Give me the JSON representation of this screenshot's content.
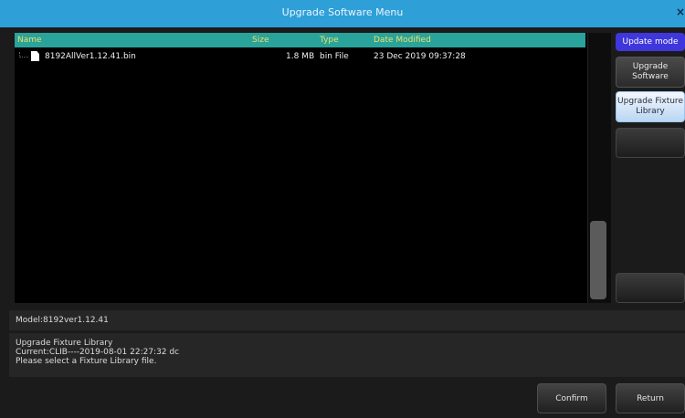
{
  "window": {
    "title": "Upgrade Software Menu",
    "close_glyph": "×"
  },
  "file_table": {
    "columns": {
      "name": "Name",
      "size": "Size",
      "type": "Type",
      "date": "Date Modified"
    },
    "rows": [
      {
        "name": "8192AllVer1.12.41.bin",
        "size": "1.8 MB",
        "type": "bin File",
        "date": "23 Dec 2019 09:37:28"
      }
    ],
    "scroll_position": 0.7
  },
  "side_menu": {
    "update_mode": "Update mode",
    "upgrade_software": "Upgrade Software",
    "upgrade_fixture_library": "Upgrade Fixture Library"
  },
  "status": {
    "model": "Model:8192ver1.12.41",
    "info_line1": "Upgrade Fixture Library",
    "info_line2": "Current:CLIB----2019-08-01 22:27:32 dc",
    "info_line3": "Please select a Fixture Library file."
  },
  "buttons": {
    "confirm": "Confirm",
    "return": "Return"
  },
  "colors": {
    "titlebar": "#2f9fd8",
    "header": "#2aa39a",
    "header_text": "#e8e26a",
    "mode_button": "#3f37dc"
  }
}
